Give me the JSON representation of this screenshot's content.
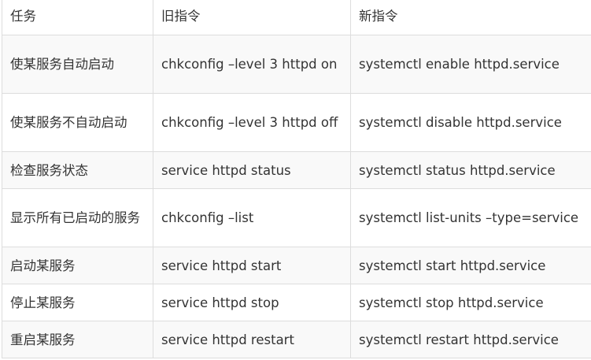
{
  "headers": [
    "任务",
    "旧指令",
    "新指令"
  ],
  "rows": [
    {
      "task": "使某服务自动启动",
      "old": "chkconfig –level 3 httpd on",
      "new": "systemctl enable httpd.service"
    },
    {
      "task": "使某服务不自动启动",
      "old": "chkconfig –level 3 httpd off",
      "new": "systemctl disable httpd.service"
    },
    {
      "task": "检查服务状态",
      "old": "service httpd status",
      "new": "systemctl status httpd.service"
    },
    {
      "task": "显示所有已启动的服务",
      "old": "chkconfig –list",
      "new": "systemctl list-units –type=service"
    },
    {
      "task": "启动某服务",
      "old": "service httpd start",
      "new": "systemctl start httpd.service"
    },
    {
      "task": "停止某服务",
      "old": "service httpd stop",
      "new": "systemctl stop httpd.service"
    },
    {
      "task": "重启某服务",
      "old": "service httpd restart",
      "new": "systemctl restart httpd.service"
    }
  ]
}
